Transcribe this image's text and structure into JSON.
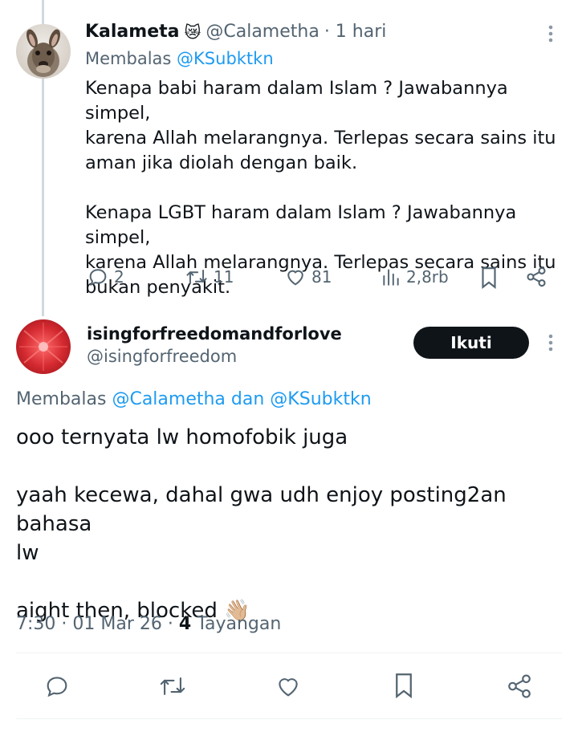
{
  "reply": {
    "author_name": "Kalameta",
    "author_emoji": "😿",
    "author_handle": "@Calametha",
    "time_ago": "· 1 hari",
    "replying_prefix": "Membalas",
    "replying_to": "@KSubktkn",
    "paragraphs": [
      "Kenapa babi haram dalam Islam ? Jawabannya simpel, karena Allah melarangnya. Terlepas secara sains itu aman jika diolah dengan baik.",
      "Kenapa LGBT haram dalam Islam ? Jawabannya simpel, karena Allah melarangnya. Terlepas secara sains itu bukan penyakit."
    ],
    "line_texts": [
      "Kenapa babi haram dalam Islam ? Jawabannya simpel,",
      "karena Allah melarangnya. Terlepas secara sains itu",
      "aman jika diolah dengan baik.",
      "Kenapa LGBT haram dalam Islam ? Jawabannya simpel,",
      "karena Allah melarangnya. Terlepas secara sains itu",
      "bukan penyakit."
    ],
    "stats": {
      "replies": "2",
      "reposts": "11",
      "likes": "81",
      "views": "2,8rb"
    }
  },
  "main_post": {
    "author_name": "isingforfreedomandforlove",
    "author_handle": "@isingforfreedom",
    "follow_label": "Ikuti",
    "replying_prefix": "Membalas",
    "replying_to_1": "@Calametha",
    "replying_and": "dan",
    "replying_to_2": "@KSubktkn",
    "lines": [
      "ooo ternyata lw homofobik juga",
      "yaah kecewa, dahal gwa udh enjoy posting2an bahasa",
      "lw",
      "aight then, blocked"
    ],
    "wave_emoji": "👋🏼",
    "timestamp": "7:30 · 01 Mar 26 ·",
    "views_count": "4",
    "views_label": "Tayangan"
  },
  "icons": {
    "reply": "reply-icon",
    "repost": "repost-icon",
    "like": "heart-icon",
    "views": "views-icon",
    "bookmark": "bookmark-icon",
    "share": "share-icon",
    "more": "more-icon"
  },
  "colors": {
    "text": "#0f1419",
    "secondary": "#536471",
    "link": "#1d9bf0",
    "button_bg": "#0f1419",
    "button_text": "#ffffff"
  }
}
